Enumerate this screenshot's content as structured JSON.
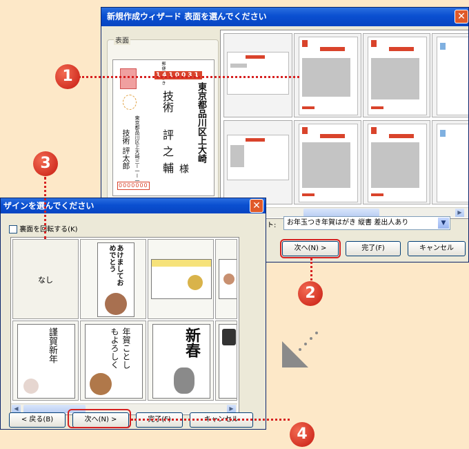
{
  "wizard_window": {
    "title": "新規作成ウィザード 表面を選んでください",
    "group_label": "表面",
    "address": {
      "postal_label": "郵便はがき",
      "postal_code": "1410031",
      "recipient_address": "東京都品川区上大崎",
      "recipient_name_1": "技術",
      "recipient_name_2": "評之輔",
      "honorific": "様",
      "sender_address": "東京都品川区上大崎三ー一ー一",
      "sender_name": "技術 評太郎",
      "sender_code": "0000000"
    },
    "layout_select": {
      "label": "レイアウト:",
      "value": "お年玉つき年賀はがき 縦書 差出人あり"
    },
    "buttons": {
      "next": "次へ(N) >",
      "finish": "完了(F)",
      "cancel": "キャンセル"
    }
  },
  "design_window": {
    "title": "ザインを選んでください",
    "rotate_checkbox_label": "裏面を回転する(K)",
    "none_label": "なし",
    "designs": [
      {
        "text": "あけましておめでとう"
      },
      {
        "text": "謹賀新年"
      },
      {
        "text": "謹賀新年"
      },
      {
        "text": "年賀ことしもよろしく"
      },
      {
        "text": "新春"
      }
    ],
    "buttons": {
      "back": "< 戻る(B)",
      "next": "次へ(N) >",
      "finish": "完了(F)",
      "cancel": "キャンセル"
    }
  },
  "callouts": [
    "1",
    "2",
    "3",
    "4"
  ],
  "icons": [
    "close-icon",
    "dropdown-arrow-icon",
    "scroll-left-icon",
    "scroll-right-icon",
    "checkbox-icon",
    "diagonal-arrow-icon"
  ],
  "colors": {
    "background": "#fde8c8",
    "titlebar": "#0a4fd0",
    "callout": "#d62020",
    "window": "#ece9d8"
  }
}
